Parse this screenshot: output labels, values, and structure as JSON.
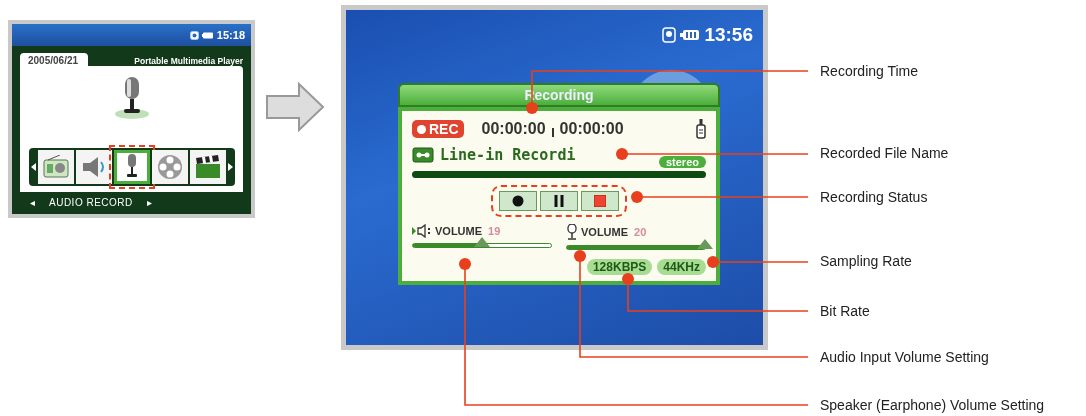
{
  "menu_screen": {
    "status_time": "15:18",
    "date": "2005/06/21",
    "title": "Portable Multimedia Player",
    "menu_items": [
      {
        "kind": "radio",
        "selected": false
      },
      {
        "kind": "speaker",
        "selected": false
      },
      {
        "kind": "microphone",
        "selected": true
      },
      {
        "kind": "reel",
        "selected": false
      },
      {
        "kind": "clapper",
        "selected": false
      }
    ],
    "prev_arrow": "◂",
    "menu_label": "AUDIO RECORD",
    "next_arrow": "▸"
  },
  "recording_screen": {
    "status_time": "13:56",
    "dialog_title": "Recording",
    "rec_badge": "REC",
    "elapsed_time": "00:00:00",
    "total_time": "00:00:00",
    "file_name": "Line-in Recordi",
    "channel_badge": "stereo",
    "buttons": [
      {
        "kind": "record"
      },
      {
        "kind": "pause"
      },
      {
        "kind": "stop"
      }
    ],
    "volumes": [
      {
        "kind": "speaker",
        "label": "VOLUME",
        "value": "19",
        "level": 0.5
      },
      {
        "kind": "microphone",
        "label": "VOLUME",
        "value": "20",
        "level": 1.0
      }
    ],
    "bit_rate": "128KBPS",
    "sampling_rate": "44KHz"
  },
  "callouts": [
    {
      "label": "Recording Time"
    },
    {
      "label": "Recorded File Name"
    },
    {
      "label": "Recording Status"
    },
    {
      "label": "Sampling Rate"
    },
    {
      "label": "Bit Rate"
    },
    {
      "label": "Audio Input Volume Setting"
    },
    {
      "label": "Speaker (Earphone) Volume Setting"
    }
  ]
}
